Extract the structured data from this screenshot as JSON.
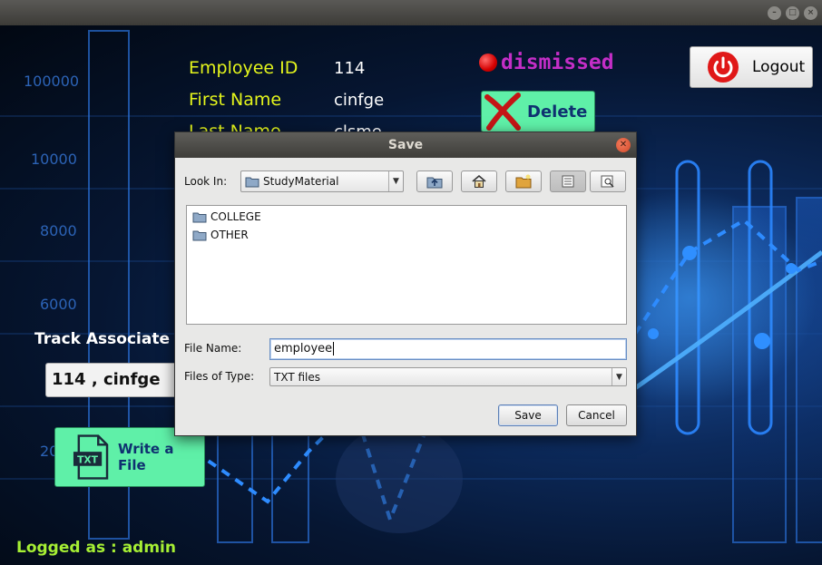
{
  "window": {
    "controls": [
      "minimize",
      "maximize",
      "close"
    ]
  },
  "chart_axis": {
    "labels": [
      "100000",
      "10000",
      "8000",
      "6000",
      "20"
    ]
  },
  "employee": {
    "id_label": "Employee ID",
    "id_value": "114",
    "first_label": "First Name",
    "first_value": "cinfge",
    "last_label": "Last Name",
    "last_value": "clsme"
  },
  "status": {
    "text": "dismissed",
    "color": "#c42ec7"
  },
  "buttons": {
    "delete": "Delete",
    "logout": "Logout",
    "write_file": "Write a File",
    "txt_icon": "TXT"
  },
  "track": {
    "label": "Track Associate De",
    "selected": "114 , cinfge"
  },
  "footer": {
    "logged_as": "Logged as  :  admin"
  },
  "dialog": {
    "title": "Save",
    "look_in_label": "Look In:",
    "look_in_value": "StudyMaterial",
    "toolbar_icons": [
      "up-folder-icon",
      "home-icon",
      "new-folder-icon",
      "list-view-icon",
      "details-view-icon"
    ],
    "files": [
      {
        "name": "COLLEGE",
        "icon": "folder-icon"
      },
      {
        "name": "OTHER",
        "icon": "folder-icon"
      }
    ],
    "file_name_label": "File Name:",
    "file_name_value": "employee",
    "file_type_label": "Files of Type:",
    "file_type_value": "TXT files",
    "save": "Save",
    "cancel": "Cancel"
  }
}
